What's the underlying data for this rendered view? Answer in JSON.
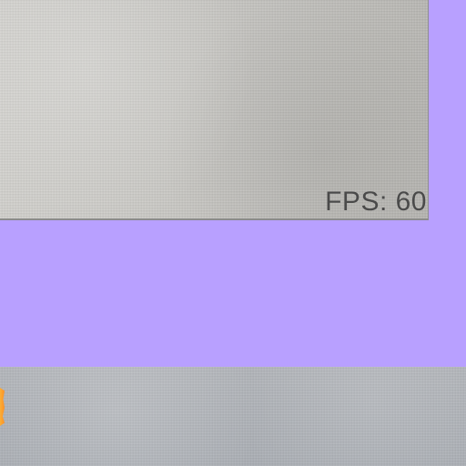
{
  "fps": {
    "text": "FPS: 60"
  },
  "colors": {
    "background": "#b8a0ff",
    "top_panel": "#c8c7c3",
    "bottom_panel": "#adb0b5",
    "fps_text": "#4a4a4a",
    "orange_marker": "#ff9a22"
  }
}
